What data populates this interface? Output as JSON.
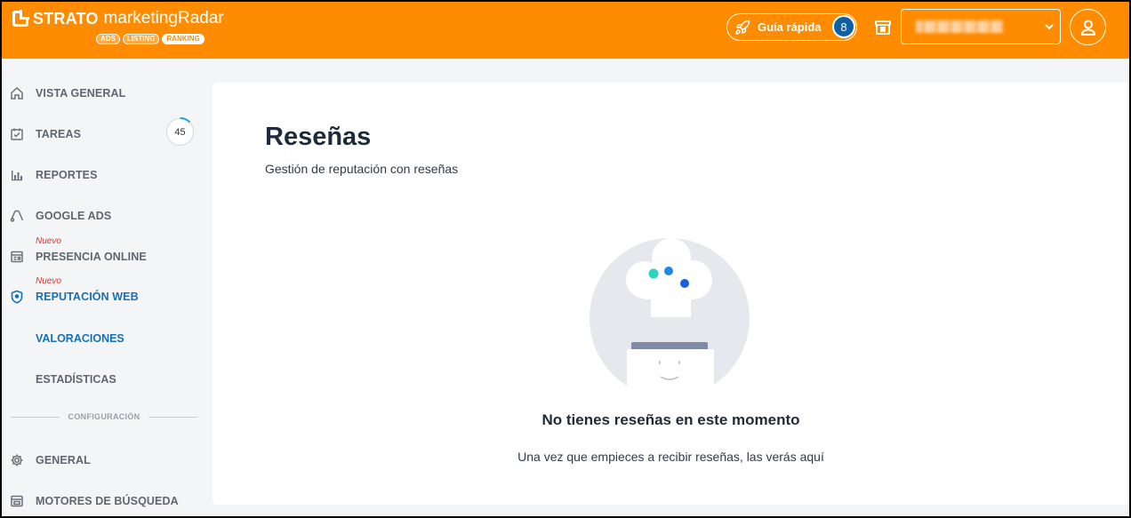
{
  "header": {
    "brand": "STRATO",
    "product": "marketingRadar",
    "pills": [
      "ADS",
      "LISTING",
      "RANKING"
    ],
    "quick_guide_label": "Guía rápida",
    "quick_guide_count": "8",
    "account_selector_value": "",
    "colors": {
      "brand": "#ff8c00",
      "badge": "#0d5fa6"
    }
  },
  "sidebar": {
    "items": [
      {
        "label": "VISTA GENERAL",
        "icon": "home-icon"
      },
      {
        "label": "TAREAS",
        "icon": "checkbox-icon",
        "count": "45"
      },
      {
        "label": "REPORTES",
        "icon": "bar-chart-icon"
      },
      {
        "label": "GOOGLE ADS",
        "icon": "google-ads-icon"
      },
      {
        "label": "PRESENCIA ONLINE",
        "icon": "store-listing-icon",
        "tag": "Nuevo"
      },
      {
        "label": "REPUTACIÓN WEB",
        "icon": "shield-icon",
        "tag": "Nuevo",
        "active": true
      }
    ],
    "subitems": [
      {
        "label": "VALORACIONES",
        "active": true
      },
      {
        "label": "ESTADÍSTICAS"
      }
    ],
    "section_label": "CONFIGURACIÓN",
    "settings_items": [
      {
        "label": "GENERAL",
        "icon": "gear-icon"
      },
      {
        "label": "MOTORES DE BÚSQUEDA",
        "icon": "browser-icon"
      }
    ],
    "active_color": "#1570b8"
  },
  "main": {
    "title": "Reseñas",
    "subtitle": "Gestión de reputación con reseñas",
    "empty_title": "No tienes reseñas en este momento",
    "empty_text": "Una vez que empieces a recibir reseñas, las verás aquí"
  }
}
